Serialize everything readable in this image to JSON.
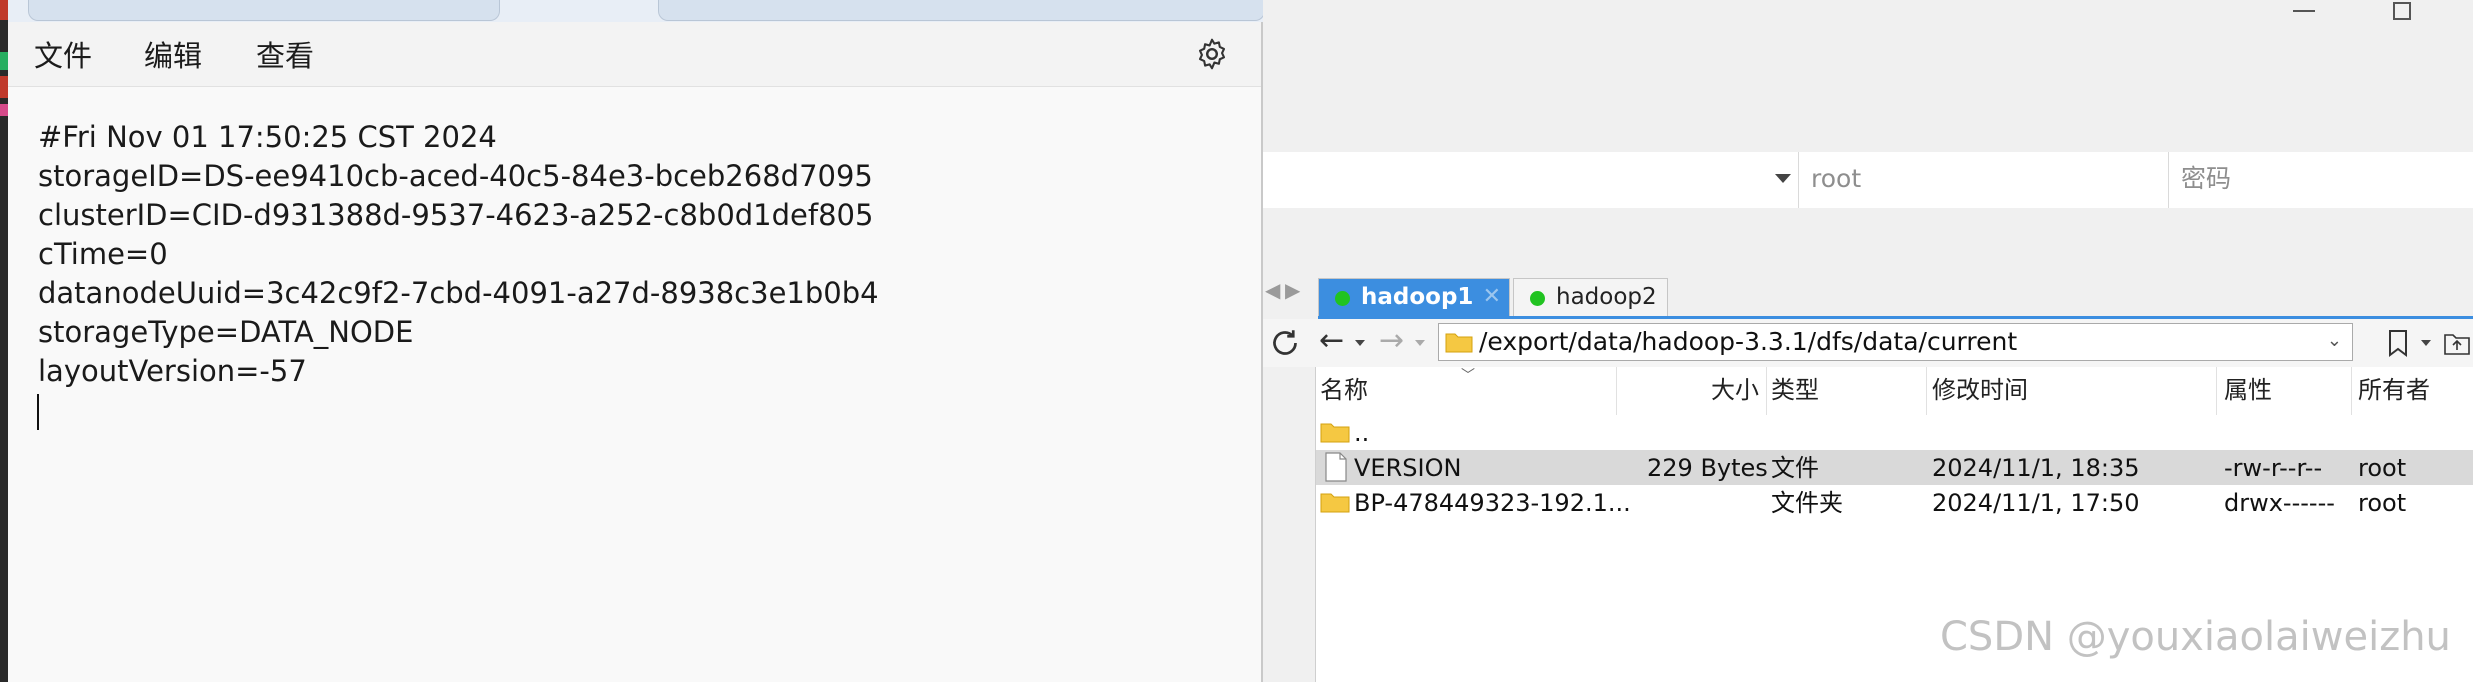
{
  "notepad": {
    "menu": {
      "file": "文件",
      "edit": "编辑",
      "view": "查看"
    },
    "lines": [
      "#Fri Nov 01 17:50:25 CST 2024",
      "storageID=DS-ee9410cb-aced-40c5-84e3-bceb268d7095",
      "clusterID=CID-d931388d-9537-4623-a252-c8b0d1def805",
      "cTime=0",
      "datanodeUuid=3c42c9f2-7cbd-4091-a27d-8938c3e1b0b4",
      "storageType=DATA_NODE",
      "layoutVersion=-57"
    ]
  },
  "connection": {
    "user_placeholder": "root",
    "password_placeholder": "密码"
  },
  "sessions": {
    "tabs": [
      {
        "label": "hadoop1",
        "active": true,
        "status_color": "#21c321"
      },
      {
        "label": "hadoop2",
        "active": false,
        "status_color": "#21c321"
      }
    ]
  },
  "browser": {
    "path": "/export/data/hadoop-3.3.1/dfs/data/current",
    "columns": {
      "name": "名称",
      "size": "大小",
      "type": "类型",
      "modified": "修改时间",
      "perms": "属性",
      "owner": "所有者"
    },
    "rows": [
      {
        "icon": "folder-icon",
        "name": "..",
        "size": "",
        "type": "",
        "modified": "",
        "perms": "",
        "owner": "",
        "selected": false
      },
      {
        "icon": "file-icon",
        "name": "VERSION",
        "size": "229 Bytes",
        "type": "文件",
        "modified": "2024/11/1, 18:35",
        "perms": "-rw-r--r--",
        "owner": "root",
        "selected": true
      },
      {
        "icon": "folder-icon",
        "name": "BP-478449323-192.1...",
        "size": "",
        "type": "文件夹",
        "modified": "2024/11/1, 17:50",
        "perms": "drwx------",
        "owner": "root",
        "selected": false
      }
    ]
  },
  "watermark": "CSDN @youxiaolaiweizhu",
  "colors": {
    "accent": "#3c8ee0",
    "online": "#21c321",
    "folder": "#f5c842"
  }
}
